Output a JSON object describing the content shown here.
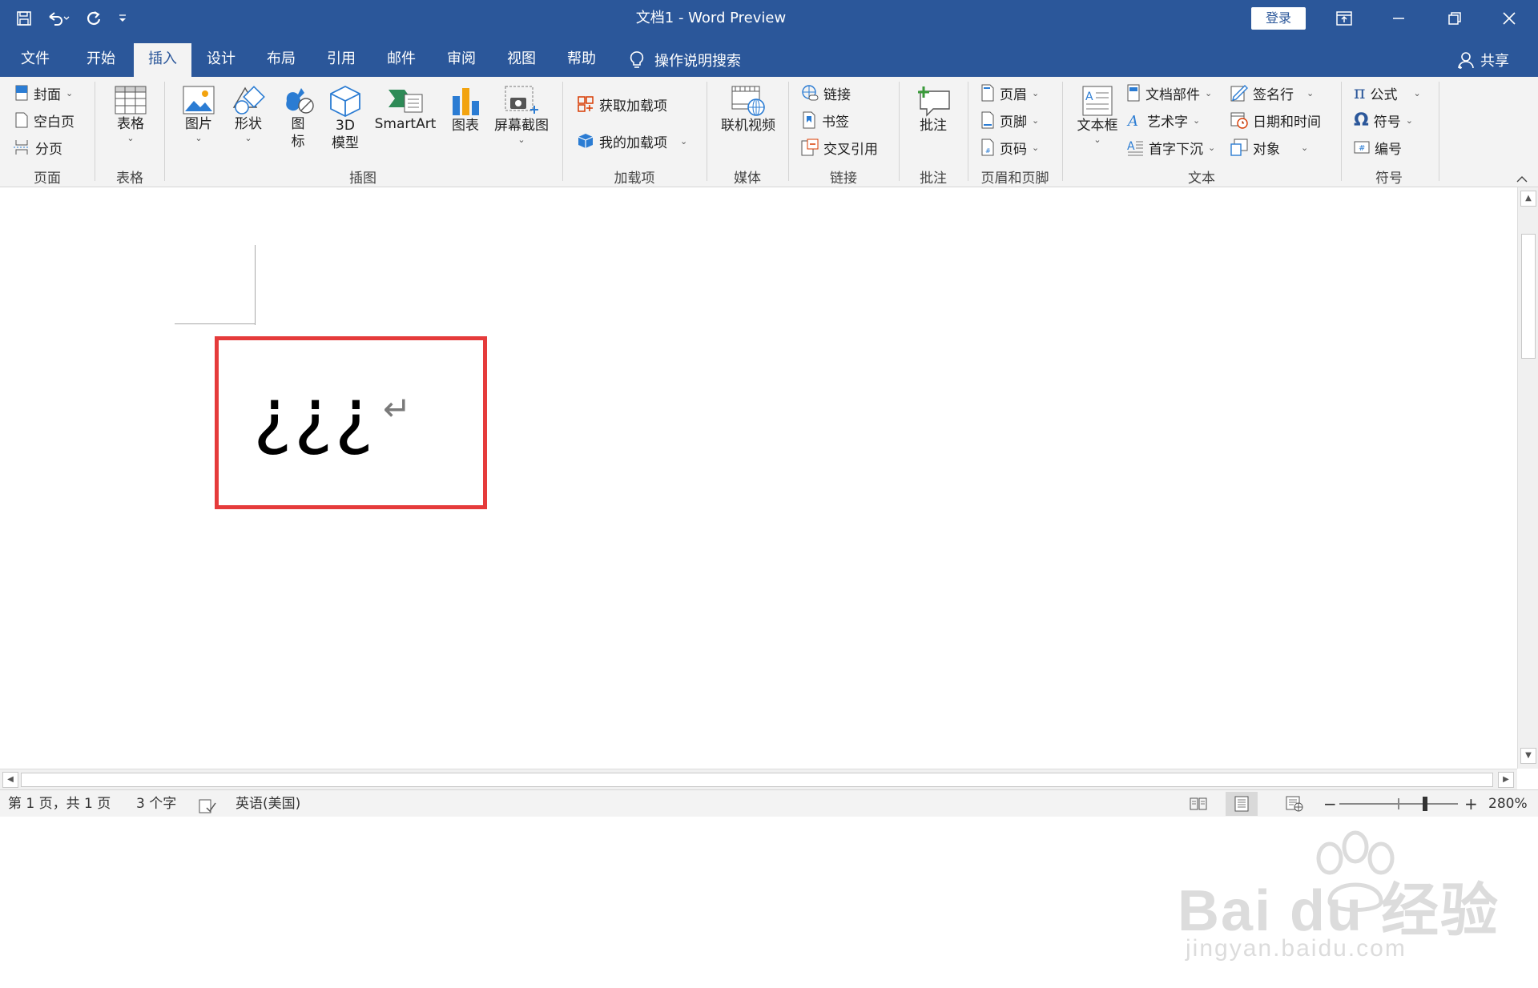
{
  "window": {
    "title": "文档1  -  Word Preview",
    "login_label": "登录"
  },
  "tabs": [
    "文件",
    "开始",
    "插入",
    "设计",
    "布局",
    "引用",
    "邮件",
    "审阅",
    "视图",
    "帮助"
  ],
  "active_tab": "插入",
  "search_label": "操作说明搜索",
  "share_label": "共享",
  "ribbon": {
    "pages": {
      "cover": "封面",
      "blank": "空白页",
      "break": "分页",
      "group": "页面"
    },
    "tables": {
      "table": "表格",
      "group": "表格"
    },
    "illustrations": {
      "picture": "图片",
      "shapes": "形状",
      "icons_1": "图",
      "icons_2": "标",
      "model_1": "3D",
      "model_2": "模型",
      "smartart": "SmartArt",
      "chart": "图表",
      "screenshot": "屏幕截图",
      "group": "插图"
    },
    "addins": {
      "get": "获取加载项",
      "my": "我的加载项",
      "group": "加载项"
    },
    "media": {
      "video": "联机视频",
      "group": "媒体"
    },
    "links": {
      "link": "链接",
      "bookmark": "书签",
      "crossref": "交叉引用",
      "group": "链接"
    },
    "comments": {
      "comment": "批注",
      "group": "批注"
    },
    "header_footer": {
      "header": "页眉",
      "footer": "页脚",
      "page_number": "页码",
      "group": "页眉和页脚"
    },
    "text": {
      "textbox": "文本框",
      "quick_parts": "文档部件",
      "wordart": "艺术字",
      "dropcap": "首字下沉",
      "signature": "签名行",
      "datetime": "日期和时间",
      "object": "对象",
      "group": "文本"
    },
    "symbols": {
      "equation": "公式",
      "symbol": "符号",
      "number": "编号",
      "group": "符号"
    }
  },
  "document": {
    "text": "¿¿¿",
    "paragraph_mark": "↵",
    "highlight_color": "#e53b3b"
  },
  "status": {
    "page": "第 1 页，共 1 页",
    "words": "3 个字",
    "language": "英语(美国)",
    "zoom": "280%",
    "zoom_minus": "−",
    "zoom_plus": "+"
  },
  "watermark": {
    "main": "Bai du 经验",
    "sub": "jingyan.baidu.com"
  },
  "colors": {
    "brand": "#2b579a",
    "ribbon_bg": "#f3f3f3"
  }
}
